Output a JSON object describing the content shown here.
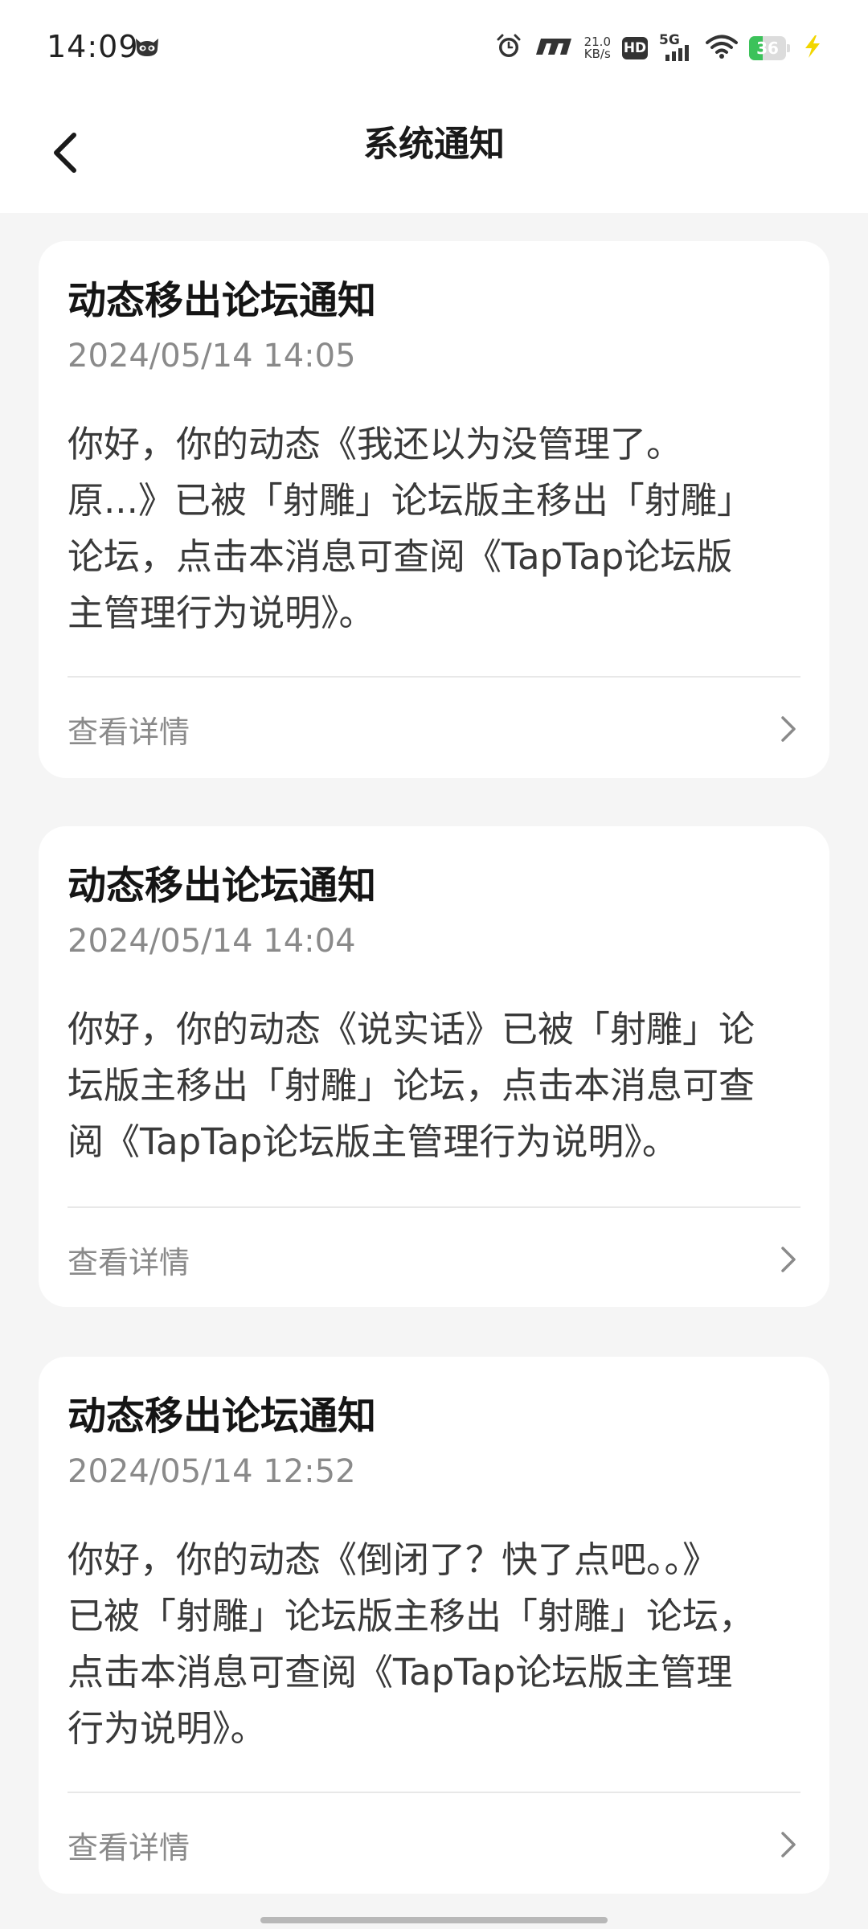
{
  "status_bar": {
    "time": "14:09",
    "net_speed_value": "21.0",
    "net_speed_unit": "KB/s",
    "hd_label": "HD",
    "signal_label": "5G",
    "battery_level": "36",
    "icons": [
      "cat-face-icon",
      "alarm-icon",
      "carrier-logo-icon",
      "hd-icon",
      "signal-5g-icon",
      "wifi-icon",
      "battery-icon",
      "charging-bolt-icon"
    ]
  },
  "header": {
    "title": "系统通知",
    "back_icon": "chevron-left-icon"
  },
  "notifications": [
    {
      "title": "动态移出论坛通知",
      "time": "2024/05/14 14:05",
      "body": "你好，你的动态《我还以为没管理了。\n原...》已被「射雕」论坛版主移出「射雕」\n论坛，点击本消息可查阅《TapTap论坛版\n主管理行为说明》。",
      "detail_label": "查看详情"
    },
    {
      "title": "动态移出论坛通知",
      "time": "2024/05/14 14:04",
      "body": "你好，你的动态《说实话》已被「射雕」论\n坛版主移出「射雕」论坛，点击本消息可查\n阅《TapTap论坛版主管理行为说明》。",
      "detail_label": "查看详情"
    },
    {
      "title": "动态移出论坛通知",
      "time": "2024/05/14 12:52",
      "body": "你好，你的动态《倒闭了？快了点吧。。》\n已被「射雕」论坛版主移出「射雕」论坛，\n点击本消息可查阅《TapTap论坛版主管理\n行为说明》。",
      "detail_label": "查看详情"
    }
  ],
  "colors": {
    "page_bg": "#f5f5f5",
    "card_bg": "#ffffff",
    "muted_text": "#8a8a8a",
    "battery_green": "#3cc25a",
    "charging_yellow": "#f2d600"
  }
}
